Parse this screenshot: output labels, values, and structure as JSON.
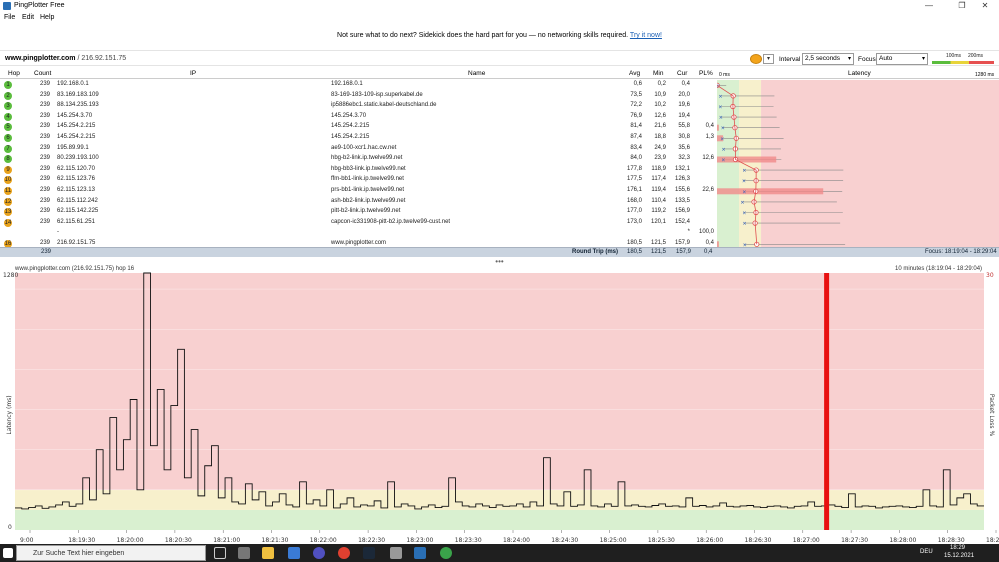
{
  "window": {
    "title": "PingPlotter Free",
    "minimize": "—",
    "maximize": "❐",
    "close": "✕"
  },
  "menu": [
    "File",
    "Edit",
    "Help"
  ],
  "promo": {
    "text": "Not sure what to do next? Sidekick does the hard part for you — no networking skills required.",
    "link": "Try it now!"
  },
  "target": {
    "host": "www.pingplotter.com",
    "ip": "216.92.151.75"
  },
  "controls": {
    "interval_label": "Interval",
    "interval_value": "2,5 seconds",
    "focus_label": "Focus",
    "focus_value": "Auto",
    "legend_100": "100ms",
    "legend_200": "200ms"
  },
  "table": {
    "headers": {
      "hop": "Hop",
      "count": "Count",
      "ip": "IP",
      "name": "Name",
      "avg": "Avg",
      "min": "Min",
      "cur": "Cur",
      "pl": "PL%",
      "latency": "Latency",
      "lat0": "0 ms",
      "latmax": "1280 ms"
    },
    "rows": [
      {
        "hop": "1",
        "count": "239",
        "ip": "192.168.0.1",
        "name": "192.168.0.1",
        "avg": "0,6",
        "min": "0,2",
        "cur": "0,4",
        "pl": "",
        "color": "#5bbd3d"
      },
      {
        "hop": "2",
        "count": "239",
        "ip": "83.169.183.109",
        "name": "83-169-183-109-isp.superkabel.de",
        "avg": "73,5",
        "min": "10,9",
        "cur": "20,0",
        "pl": "",
        "color": "#5bbd3d"
      },
      {
        "hop": "3",
        "count": "239",
        "ip": "88.134.235.193",
        "name": "ip5886ebc1.static.kabel-deutschland.de",
        "avg": "72,2",
        "min": "10,2",
        "cur": "19,6",
        "pl": "",
        "color": "#5bbd3d"
      },
      {
        "hop": "4",
        "count": "239",
        "ip": "145.254.3.70",
        "name": "145.254.3.70",
        "avg": "76,9",
        "min": "12,6",
        "cur": "19,4",
        "pl": "",
        "color": "#5bbd3d"
      },
      {
        "hop": "5",
        "count": "239",
        "ip": "145.254.2.215",
        "name": "145.254.2.215",
        "avg": "81,4",
        "min": "21,6",
        "cur": "55,8",
        "pl": "0,4",
        "color": "#5bbd3d"
      },
      {
        "hop": "6",
        "count": "239",
        "ip": "145.254.2.215",
        "name": "145.254.2.215",
        "avg": "87,4",
        "min": "18,8",
        "cur": "30,8",
        "pl": "1,3",
        "color": "#5bbd3d"
      },
      {
        "hop": "7",
        "count": "239",
        "ip": "195.89.99.1",
        "name": "ae9-100-xcr1.hac.cw.net",
        "avg": "83,4",
        "min": "24,9",
        "cur": "35,6",
        "pl": "",
        "color": "#5bbd3d"
      },
      {
        "hop": "8",
        "count": "239",
        "ip": "80.239.193.100",
        "name": "hbg-b2-link.ip.twelve99.net",
        "avg": "84,0",
        "min": "23,9",
        "cur": "32,3",
        "pl": "12,6",
        "color": "#5bbd3d"
      },
      {
        "hop": "9",
        "count": "239",
        "ip": "62.115.120.70",
        "name": "hbg-bb3-link.ip.twelve99.net",
        "avg": "177,8",
        "min": "118,9",
        "cur": "132,1",
        "pl": "",
        "color": "#e8a21a"
      },
      {
        "hop": "10",
        "count": "239",
        "ip": "62.115.123.76",
        "name": "ffm-bb1-link.ip.twelve99.net",
        "avg": "177,5",
        "min": "117,4",
        "cur": "126,3",
        "pl": "",
        "color": "#e8a21a"
      },
      {
        "hop": "11",
        "count": "239",
        "ip": "62.115.123.13",
        "name": "prs-bb1-link.ip.twelve99.net",
        "avg": "176,1",
        "min": "119,4",
        "cur": "155,6",
        "pl": "22,6",
        "color": "#e8a21a"
      },
      {
        "hop": "12",
        "count": "239",
        "ip": "62.115.112.242",
        "name": "ash-bb2-link.ip.twelve99.net",
        "avg": "168,0",
        "min": "110,4",
        "cur": "133,5",
        "pl": "",
        "color": "#e8a21a"
      },
      {
        "hop": "13",
        "count": "239",
        "ip": "62.115.142.225",
        "name": "pitt-b2-link.ip.twelve99.net",
        "avg": "177,0",
        "min": "119,2",
        "cur": "156,9",
        "pl": "",
        "color": "#e8a21a"
      },
      {
        "hop": "14",
        "count": "239",
        "ip": "62.115.61.251",
        "name": "capcon-ic331908-pitt-b2.ip.twelve99-cust.net",
        "avg": "173,0",
        "min": "120,1",
        "cur": "152,4",
        "pl": "",
        "color": "#e8a21a"
      },
      {
        "hop": "",
        "count": "",
        "ip": "-",
        "name": "",
        "avg": "",
        "min": "",
        "cur": "*",
        "pl": "100,0",
        "color": ""
      },
      {
        "hop": "16",
        "count": "239",
        "ip": "216.92.151.75",
        "name": "www.pingplotter.com",
        "avg": "180,5",
        "min": "121,5",
        "cur": "157,9",
        "pl": "0,4",
        "color": "#e8a21a"
      }
    ],
    "roundtrip": {
      "count": "239",
      "label": "Round Trip (ms)",
      "avg": "180,5",
      "min": "121,5",
      "cur": "157,9",
      "pl": "0,4",
      "focus": "Focus: 18:19:04 - 18:29:04"
    }
  },
  "graph": {
    "title": "www.pingplotter.com (216.92.151.75) hop 16",
    "range": "10 minutes (18:19:04 - 18:29:04)",
    "ylabel": "Latency (ms)",
    "ylabel_right": "Packet Loss %",
    "ytop": "1280",
    "ybottom": "0",
    "right_top": "30",
    "xticks": [
      "9:00",
      "18:19:30",
      "18:20:00",
      "18:20:30",
      "18:21:00",
      "18:21:30",
      "18:22:00",
      "18:22:30",
      "18:23:00",
      "18:23:30",
      "18:24:00",
      "18:24:30",
      "18:25:00",
      "18:25:30",
      "18:26:00",
      "18:26:30",
      "18:27:00",
      "18:27:30",
      "18:28:00",
      "18:28:30",
      "18:2"
    ]
  },
  "chart_data": {
    "type": "line",
    "title": "www.pingplotter.com (216.92.151.75) hop 16",
    "ylabel": "Latency (ms)",
    "ylim": [
      0,
      1280
    ],
    "x_range": [
      "18:19:04",
      "18:29:04"
    ],
    "series": [
      {
        "values": [
          110,
          105,
          112,
          120,
          108,
          115,
          125,
          140,
          118,
          130,
          260,
          150,
          400,
          180,
          560,
          300,
          450,
          650,
          200,
          1280,
          420,
          700,
          300,
          620,
          900,
          260,
          500,
          170,
          320,
          420,
          160,
          260,
          140,
          130,
          230,
          150,
          190,
          120,
          140,
          180,
          125,
          115,
          240,
          130,
          150,
          120,
          200,
          110,
          130,
          160,
          115,
          125,
          120,
          145,
          110,
          240,
          115,
          130,
          120,
          105,
          115,
          125,
          112,
          118,
          260,
          140,
          120,
          115,
          130,
          120,
          112,
          125,
          118,
          120,
          130,
          115,
          140,
          120,
          360,
          130,
          120,
          190,
          118,
          125,
          300,
          120,
          115,
          130,
          118,
          240,
          120,
          125,
          118,
          115,
          122,
          130,
          118,
          120,
          115,
          160,
          118,
          122,
          115,
          120,
          135,
          118,
          115,
          120,
          122,
          115,
          112,
          118,
          120,
          115,
          110,
          118,
          120,
          140,
          118,
          120,
          125,
          118,
          112,
          180,
          115,
          120,
          118,
          110,
          115,
          118,
          120,
          115,
          112,
          118,
          200,
          120,
          115,
          300,
          125,
          160,
          180,
          130,
          120
        ]
      }
    ],
    "loss_events": [
      {
        "time": "18:27:25",
        "loss": "100%"
      }
    ]
  },
  "taskbar": {
    "search": "Zur Suche Text hier eingeben",
    "lang": "DEU",
    "time": "18:29",
    "date": "15.12.2021"
  }
}
